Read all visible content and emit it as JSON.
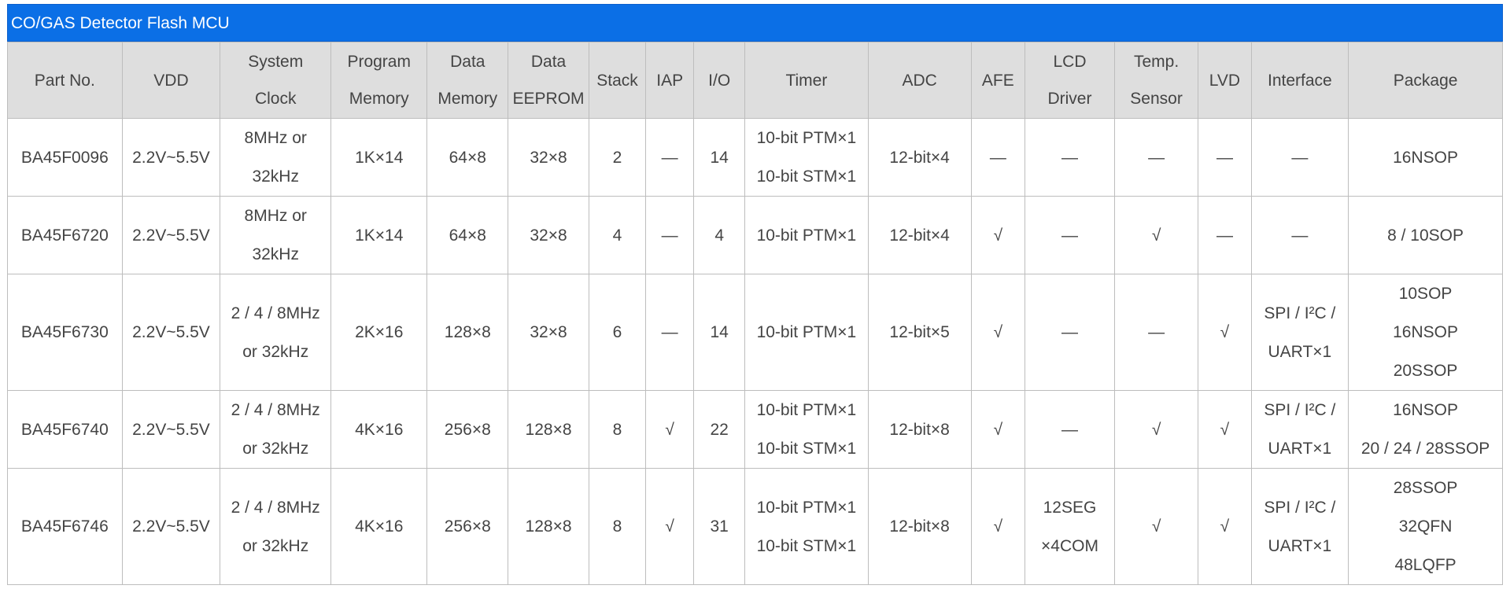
{
  "title": "CO/GAS Detector Flash MCU",
  "headers": [
    [
      "Part No."
    ],
    [
      "VDD"
    ],
    [
      "System",
      "Clock"
    ],
    [
      "Program",
      "Memory"
    ],
    [
      "Data",
      "Memory"
    ],
    [
      "Data",
      "EEPROM"
    ],
    [
      "Stack"
    ],
    [
      "IAP"
    ],
    [
      "I/O"
    ],
    [
      "Timer"
    ],
    [
      "ADC"
    ],
    [
      "AFE"
    ],
    [
      "LCD",
      "Driver"
    ],
    [
      "Temp.",
      "Sensor"
    ],
    [
      "LVD"
    ],
    [
      "Interface"
    ],
    [
      "Package"
    ]
  ],
  "rows": [
    [
      [
        "BA45F0096"
      ],
      [
        "2.2V~5.5V"
      ],
      [
        "8MHz or",
        "32kHz"
      ],
      [
        "1K×14"
      ],
      [
        "64×8"
      ],
      [
        "32×8"
      ],
      [
        "2"
      ],
      [
        "—"
      ],
      [
        "14"
      ],
      [
        "10-bit PTM×1",
        "10-bit STM×1"
      ],
      [
        "12-bit×4"
      ],
      [
        "—"
      ],
      [
        "—"
      ],
      [
        "—"
      ],
      [
        "—"
      ],
      [
        "—"
      ],
      [
        "16NSOP"
      ]
    ],
    [
      [
        "BA45F6720"
      ],
      [
        "2.2V~5.5V"
      ],
      [
        "8MHz or",
        "32kHz"
      ],
      [
        "1K×14"
      ],
      [
        "64×8"
      ],
      [
        "32×8"
      ],
      [
        "4"
      ],
      [
        "—"
      ],
      [
        "4"
      ],
      [
        "10-bit PTM×1"
      ],
      [
        "12-bit×4"
      ],
      [
        "√"
      ],
      [
        "—"
      ],
      [
        "√"
      ],
      [
        "—"
      ],
      [
        "—"
      ],
      [
        "8 / 10SOP"
      ]
    ],
    [
      [
        "BA45F6730"
      ],
      [
        "2.2V~5.5V"
      ],
      [
        "2 / 4 / 8MHz",
        "or 32kHz"
      ],
      [
        "2K×16"
      ],
      [
        "128×8"
      ],
      [
        "32×8"
      ],
      [
        "6"
      ],
      [
        "—"
      ],
      [
        "14"
      ],
      [
        "10-bit PTM×1"
      ],
      [
        "12-bit×5"
      ],
      [
        "√"
      ],
      [
        "—"
      ],
      [
        "—"
      ],
      [
        "√"
      ],
      [
        "SPI / I²C /",
        "UART×1"
      ],
      [
        "10SOP",
        "16NSOP",
        "20SSOP"
      ]
    ],
    [
      [
        "BA45F6740"
      ],
      [
        "2.2V~5.5V"
      ],
      [
        "2 / 4 / 8MHz",
        "or 32kHz"
      ],
      [
        "4K×16"
      ],
      [
        "256×8"
      ],
      [
        "128×8"
      ],
      [
        "8"
      ],
      [
        "√"
      ],
      [
        "22"
      ],
      [
        "10-bit PTM×1",
        "10-bit STM×1"
      ],
      [
        "12-bit×8"
      ],
      [
        "√"
      ],
      [
        "—"
      ],
      [
        "√"
      ],
      [
        "√"
      ],
      [
        "SPI / I²C /",
        "UART×1"
      ],
      [
        "16NSOP",
        "20 / 24 / 28SSOP"
      ]
    ],
    [
      [
        "BA45F6746"
      ],
      [
        "2.2V~5.5V"
      ],
      [
        "2 / 4 / 8MHz",
        "or 32kHz"
      ],
      [
        "4K×16"
      ],
      [
        "256×8"
      ],
      [
        "128×8"
      ],
      [
        "8"
      ],
      [
        "√"
      ],
      [
        "31"
      ],
      [
        "10-bit PTM×1",
        "10-bit STM×1"
      ],
      [
        "12-bit×8"
      ],
      [
        "√"
      ],
      [
        "12SEG",
        "×4COM"
      ],
      [
        "√"
      ],
      [
        "√"
      ],
      [
        "SPI / I²C /",
        "UART×1"
      ],
      [
        "28SSOP",
        "32QFN",
        "48LQFP"
      ]
    ]
  ],
  "colors": {
    "title_bar": "#0b6fe6",
    "header_bg": "#dedede",
    "border": "#bdbdbd",
    "text": "#444444"
  }
}
